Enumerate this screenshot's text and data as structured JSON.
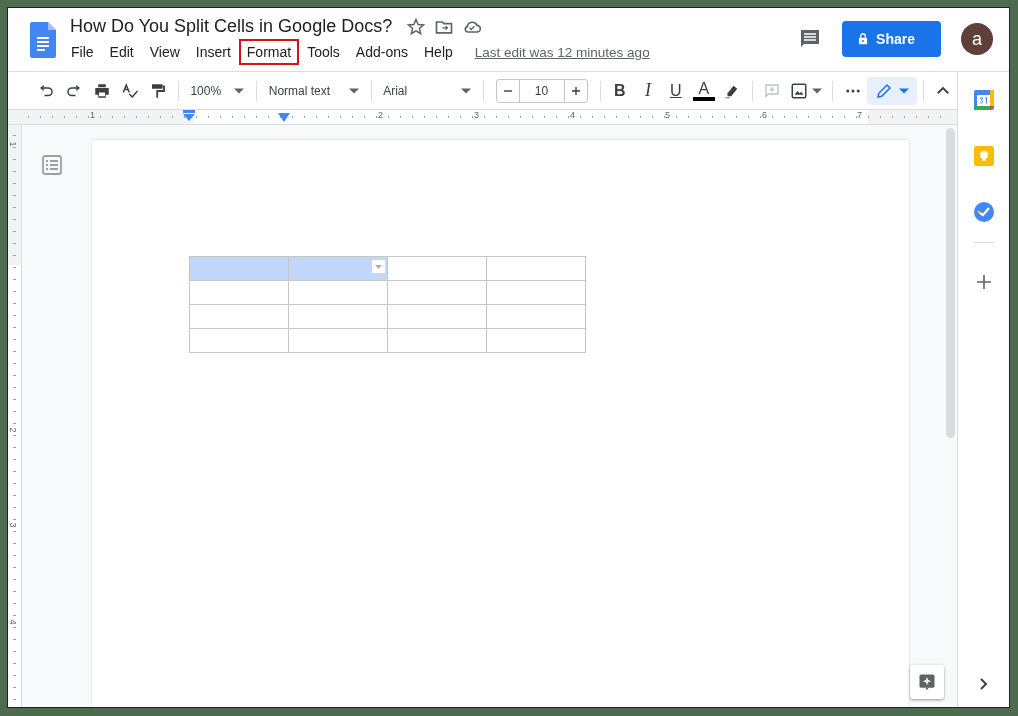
{
  "document": {
    "title": "How Do You Split Cells in Google Docs?",
    "last_edit": "Last edit was 12 minutes ago"
  },
  "menu": [
    {
      "label": "File",
      "highlighted": false
    },
    {
      "label": "Edit",
      "highlighted": false
    },
    {
      "label": "View",
      "highlighted": false
    },
    {
      "label": "Insert",
      "highlighted": false
    },
    {
      "label": "Format",
      "highlighted": true
    },
    {
      "label": "Tools",
      "highlighted": false
    },
    {
      "label": "Add-ons",
      "highlighted": false
    },
    {
      "label": "Help",
      "highlighted": false
    }
  ],
  "share_button": {
    "label": "Share"
  },
  "avatar": {
    "letter": "a"
  },
  "toolbar": {
    "zoom": "100%",
    "style": "Normal text",
    "font": "Arial",
    "font_size": "10",
    "format_buttons": [
      "B",
      "I",
      "U",
      "A"
    ]
  },
  "ruler": {
    "numbers": [
      "1",
      "2",
      "3",
      "4",
      "5",
      "6",
      "7"
    ]
  },
  "vertical_ruler": {
    "numbers": [
      "1",
      "2",
      "3",
      "4"
    ]
  },
  "table": {
    "rows": [
      {
        "cells": [
          {
            "selected": true
          },
          {
            "selected": true
          },
          {
            "selected": false
          },
          {
            "selected": false
          }
        ]
      },
      {
        "cells": [
          {
            "selected": false
          },
          {
            "selected": false
          },
          {
            "selected": false
          },
          {
            "selected": false
          }
        ]
      },
      {
        "cells": [
          {
            "selected": false
          },
          {
            "selected": false
          },
          {
            "selected": false
          },
          {
            "selected": false
          }
        ]
      },
      {
        "cells": [
          {
            "selected": false
          },
          {
            "selected": false
          },
          {
            "selected": false
          },
          {
            "selected": false
          }
        ]
      }
    ]
  }
}
